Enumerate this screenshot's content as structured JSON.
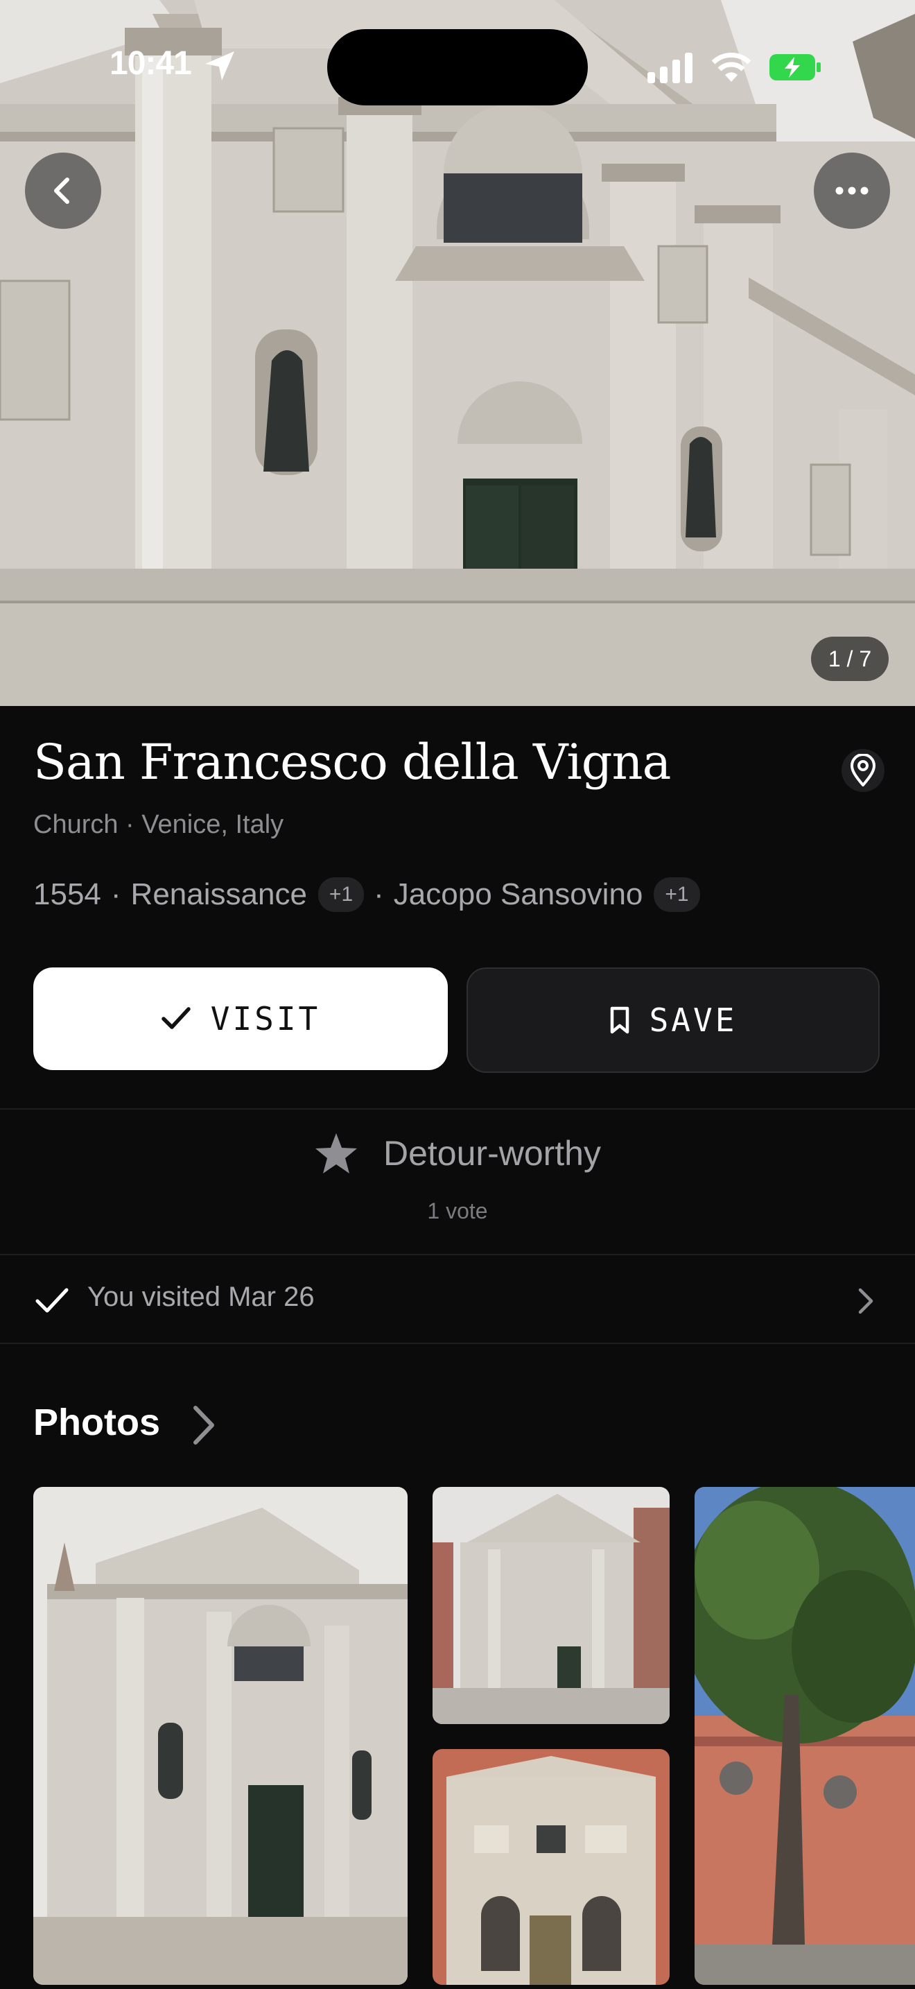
{
  "status_bar": {
    "time": "10:41"
  },
  "hero": {
    "counter": "1 / 7"
  },
  "place": {
    "name": "San Francesco della Vigna",
    "subtitle": "Church · Venice, Italy",
    "year": "1554",
    "style": "Renaissance",
    "style_more": "+1",
    "architect": "Jacopo Sansovino",
    "architect_more": "+1",
    "separator": "·"
  },
  "actions": {
    "visit_label": "VISIT",
    "save_label": "SAVE"
  },
  "rating": {
    "label": "Detour-worthy",
    "votes": "1 vote"
  },
  "visited": {
    "text": "You visited Mar 26"
  },
  "photos": {
    "title": "Photos"
  },
  "icons": {
    "back": "chevron-left-icon",
    "more": "ellipsis-icon",
    "pin": "map-pin-icon",
    "check": "checkmark-icon",
    "bookmark": "bookmark-icon",
    "star": "star-icon",
    "chevron": "chevron-right-icon"
  },
  "colors": {
    "background": "#0b0b0c",
    "battery": "#32d74b",
    "muted_text": "#a9a9ad"
  }
}
